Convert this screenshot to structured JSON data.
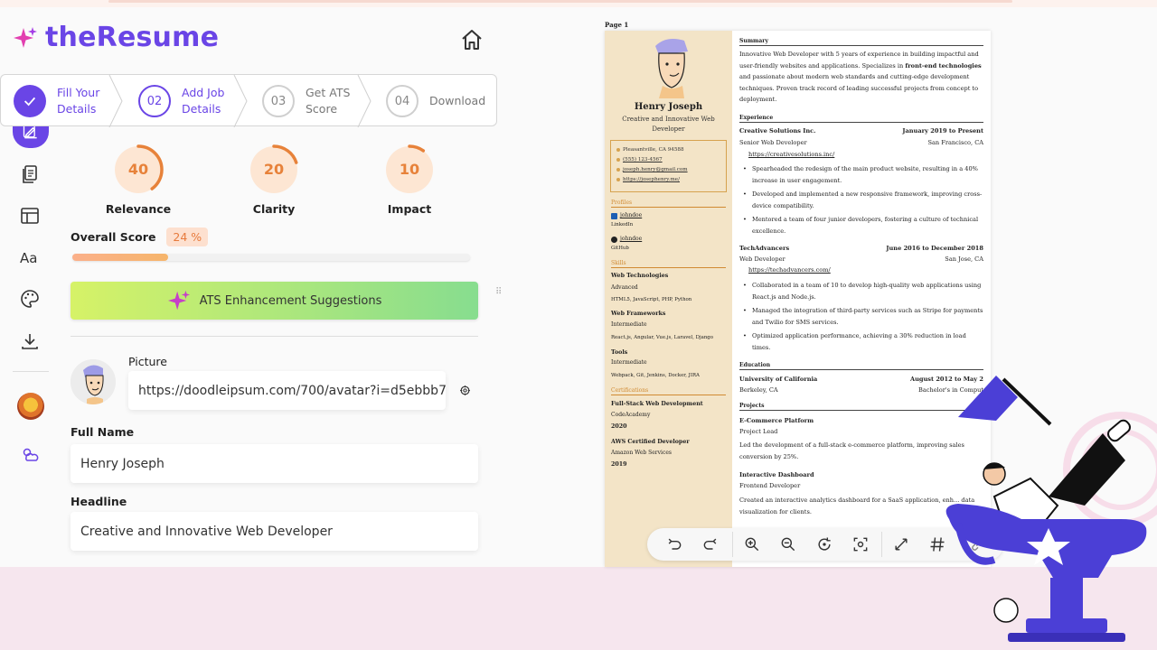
{
  "app": {
    "name": "theResume"
  },
  "stepper": [
    {
      "label_line1": "Fill Your",
      "label_line2": "Details",
      "state": "done"
    },
    {
      "number": "02",
      "label_line1": "Add Job",
      "label_line2": "Details",
      "state": "active"
    },
    {
      "number": "03",
      "label_line1": "Get ATS",
      "label_line2": "Score",
      "state": "todo"
    },
    {
      "number": "04",
      "label_line1": "Download",
      "label_line2": "",
      "state": "todo"
    }
  ],
  "rail": [
    "edit-icon",
    "documents-icon",
    "layout-icon",
    "typography-icon",
    "palette-icon",
    "download-icon",
    "profile-avatar",
    "weather-icon"
  ],
  "scores": [
    {
      "value": "40",
      "label": "Relevance",
      "fraction": 0.4
    },
    {
      "value": "20",
      "label": "Clarity",
      "fraction": 0.2
    },
    {
      "value": "10",
      "label": "Impact",
      "fraction": 0.1
    }
  ],
  "overall": {
    "label": "Overall Score",
    "value": "24 %",
    "fraction": 0.24
  },
  "ats_button": {
    "label": "ATS Enhancement Suggestions"
  },
  "form": {
    "picture_label": "Picture",
    "picture_url": "https://doodleipsum.com/700/avatar?i=d5ebbb7",
    "fullname_label": "Full Name",
    "fullname_value": "Henry Joseph",
    "headline_label": "Headline",
    "headline_value": "Creative and Innovative Web Developer"
  },
  "resume": {
    "page_label": "Page 1",
    "name": "Henry Joseph",
    "headline": "Creative and Innovative Web Developer",
    "contact": [
      "Pleasantville, CA 94588",
      "(555) 123-4567",
      "joseph.henry@gmail.com",
      "https://josephenry.me/"
    ],
    "profiles_title": "Profiles",
    "profiles": [
      {
        "handle": "johndoe",
        "network": "LinkedIn"
      },
      {
        "handle": "johndoe",
        "network": "GitHub"
      }
    ],
    "skills_title": "Skills",
    "skills": [
      {
        "name": "Web Technologies",
        "level": "Advanced",
        "keywords": "HTML5, JavaScript, PHP, Python"
      },
      {
        "name": "Web Frameworks",
        "level": "Intermediate",
        "keywords": "React.js, Angular, Vue.js, Laravel, Django"
      },
      {
        "name": "Tools",
        "level": "Intermediate",
        "keywords": "Webpack, Git, Jenkins, Docker, JIRA"
      }
    ],
    "certs_title": "Certifications",
    "certs": [
      {
        "name": "Full-Stack Web Development",
        "issuer": "CodeAcademy",
        "year": "2020"
      },
      {
        "name": "AWS Certified Developer",
        "issuer": "Amazon Web Services",
        "year": "2019"
      }
    ],
    "summary_title": "Summary",
    "summary_pre": "Innovative Web Developer with 5 years of experience in building impactful and user-friendly websites and applications. Specializes in ",
    "summary_bold": "front-end technologies",
    "summary_post": " and passionate about modern web standards and cutting-edge development techniques. Proven track record of leading successful projects from concept to deployment.",
    "experience_title": "Experience",
    "jobs": [
      {
        "company": "Creative Solutions Inc.",
        "dates": "January 2019 to Present",
        "role": "Senior Web Developer",
        "location": "San Francisco, CA",
        "url": "https://creativesolutions.inc/",
        "bullets": [
          "Spearheaded the redesign of the main product website, resulting in a 40% increase in user engagement.",
          "Developed and implemented a new responsive framework, improving cross-device compatibility.",
          "Mentored a team of four junior developers, fostering a culture of technical excellence."
        ]
      },
      {
        "company": "TechAdvancers",
        "dates": "June 2016 to December 2018",
        "role": "Web Developer",
        "location": "San Jose, CA",
        "url": "https://techadvancers.com/",
        "bullets": [
          "Collaborated in a team of 10 to develop high-quality web applications using React.js and Node.js.",
          "Managed the integration of third-party services such as Stripe for payments and Twilio for SMS services.",
          "Optimized application performance, achieving a 30% reduction in load times."
        ]
      }
    ],
    "education_title": "Education",
    "education": {
      "school": "University of California",
      "dates": "August 2012 to May 2",
      "location": "Berkeley, CA",
      "degree": "Bachelor's in Comput"
    },
    "projects_title": "Projects",
    "projects": [
      {
        "name": "E-Commerce Platform",
        "role": "Project Lead",
        "desc": "Led the development of a full-stack e-commerce platform, improving sales conversion by 25%."
      },
      {
        "name": "Interactive Dashboard",
        "role": "Frontend Developer",
        "desc": "Created an interactive analytics dashboard for a SaaS application, enh... data visualization for clients."
      }
    ]
  },
  "toolbar": [
    "undo-icon",
    "redo-icon",
    "zoom-in-icon",
    "zoom-out-icon",
    "reset-zoom-icon",
    "center-icon",
    "expand-icon",
    "grid-icon",
    "link-icon"
  ],
  "colors": {
    "accent": "#6a45e6",
    "score": "#e7823a",
    "resume_sidebar": "#f3e4c7",
    "band": "#f6e6ee"
  }
}
